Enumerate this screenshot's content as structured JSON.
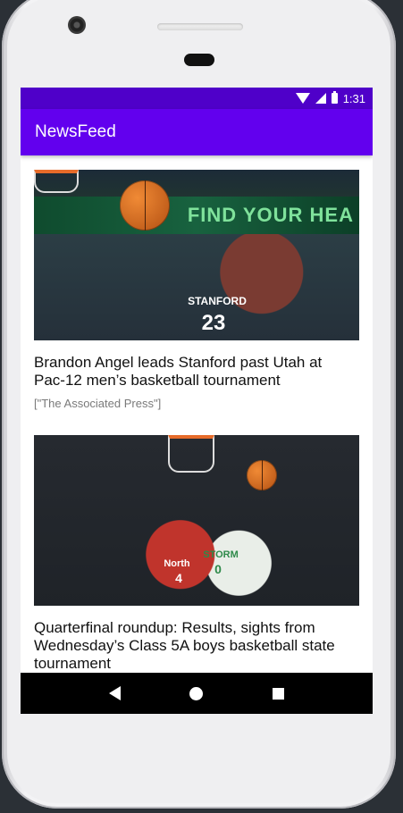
{
  "status_bar": {
    "time": "1:31"
  },
  "app_bar": {
    "title": "NewsFeed"
  },
  "articles": [
    {
      "headline": "Brandon Angel leads Stanford past Utah at Pac-12 men’s basketball tournament",
      "source": "[\"The Associated Press\"]",
      "image": {
        "banner_text": "FIND YOUR HEA",
        "jersey_text": "STANFORD",
        "jersey_number": "23"
      }
    },
    {
      "headline": "Quarterfinal roundup: Results, sights from Wednesday’s Class 5A boys basketball state tournament",
      "image": {
        "jersey_text_left": "North",
        "jersey_number_left": "4",
        "jersey_text_right": "STORM",
        "jersey_number_right": "0"
      }
    }
  ],
  "colors": {
    "status_bar": "#4f00c9",
    "app_bar": "#6200ee",
    "nav_bar": "#000000"
  },
  "nav_bar": {
    "icons": [
      "back-icon",
      "home-icon",
      "recents-icon"
    ]
  }
}
